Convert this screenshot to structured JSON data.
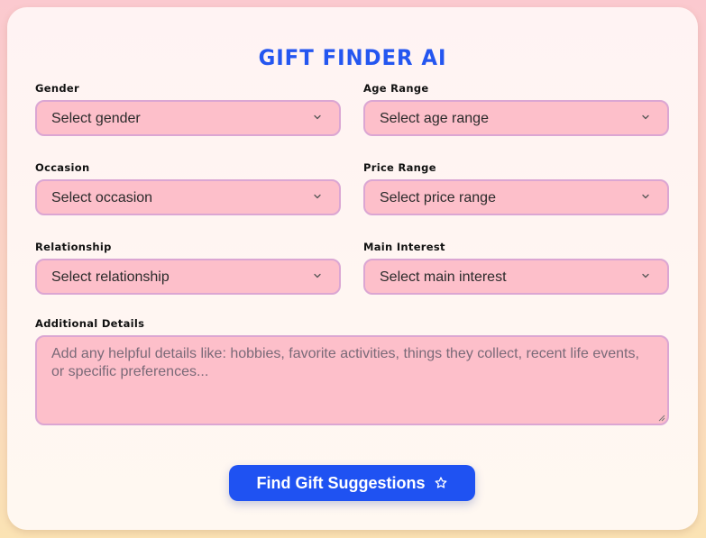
{
  "app": {
    "title": "GIFT FINDER AI"
  },
  "form": {
    "fields": [
      {
        "label": "Gender",
        "value": "Select gender"
      },
      {
        "label": "Age Range",
        "value": "Select age range"
      },
      {
        "label": "Occasion",
        "value": "Select occasion"
      },
      {
        "label": "Price Range",
        "value": "Select price range"
      },
      {
        "label": "Relationship",
        "value": "Select relationship"
      },
      {
        "label": "Main Interest",
        "value": "Select main interest"
      }
    ],
    "details": {
      "label": "Additional Details",
      "value": "",
      "placeholder": "Add any helpful details like: hobbies, favorite activities, things they collect, recent life events, or specific preferences..."
    },
    "submit": {
      "label": "Find Gift Suggestions",
      "icon": "star-icon"
    }
  },
  "colors": {
    "accent": "#1f52f2",
    "field_bg": "#fdbfca",
    "field_border": "#dba6d3"
  }
}
